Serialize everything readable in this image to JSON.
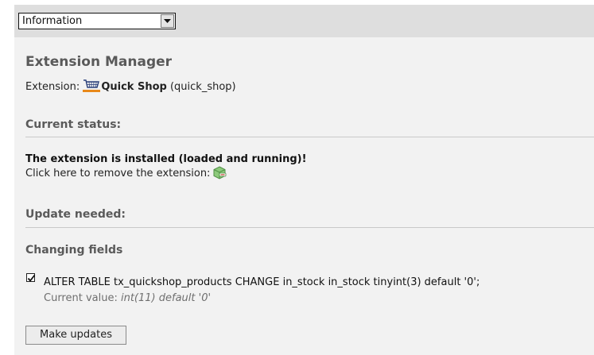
{
  "function_menu": {
    "selected": "Information"
  },
  "page": {
    "title": "Extension Manager",
    "extension_label": "Extension: ",
    "extension_name": "Quick Shop",
    "extension_key": " (quick_shop)"
  },
  "status": {
    "heading": "Current status:",
    "installed_message": "The extension is installed (loaded and running)!",
    "remove_prompt": "Click here to remove the extension:"
  },
  "update": {
    "heading": "Update needed:",
    "changing_fields_heading": "Changing fields",
    "statement_checked": true,
    "sql_statement": "ALTER TABLE tx_quickshop_products CHANGE in_stock in_stock tinyint(3) default '0';",
    "current_value_label": "Current value: ",
    "current_value": "int(11) default '0'",
    "submit_label": "Make updates"
  },
  "icons": {
    "menu_dropdown": "chevron-down-icon",
    "extension": "shopping-cart-icon",
    "remove": "remove-extension-icon",
    "checkbox": "checkmark-icon"
  }
}
